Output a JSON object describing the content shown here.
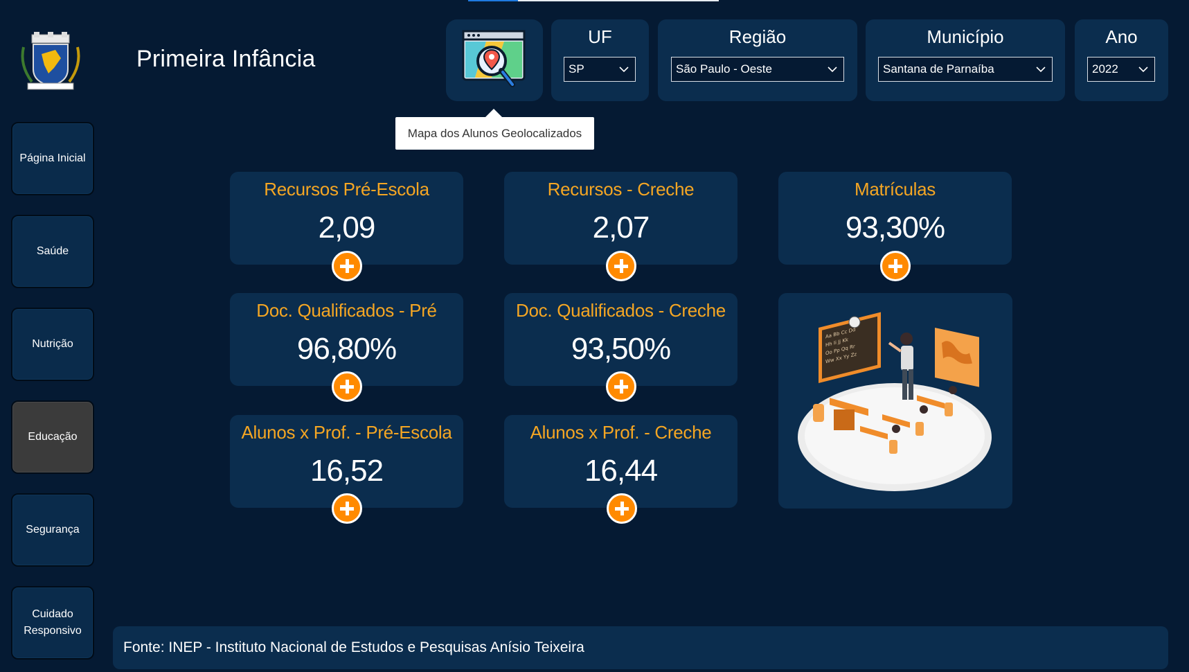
{
  "header": {
    "title": "Primeira Infância",
    "logo_icon": "municipal-coat-of-arms"
  },
  "nav": {
    "items": [
      {
        "label": "Página Inicial"
      },
      {
        "label": "Saúde"
      },
      {
        "label": "Nutrição"
      },
      {
        "label": "Educação",
        "active": true
      },
      {
        "label": "Segurança"
      },
      {
        "label": "Cuidado Responsivo"
      }
    ]
  },
  "map_button": {
    "icon": "map-search-icon",
    "tooltip": "Mapa dos Alunos Geolocalizados"
  },
  "filters": {
    "uf": {
      "label": "UF",
      "value": "SP"
    },
    "regiao": {
      "label": "Região",
      "value": "São Paulo - Oeste"
    },
    "municipio": {
      "label": "Município",
      "value": "Santana de Parnaíba"
    },
    "ano": {
      "label": "Ano",
      "value": "2022"
    }
  },
  "kpis": [
    {
      "title": "Recursos Pré-Escola",
      "value": "2,09"
    },
    {
      "title": "Recursos - Creche",
      "value": "2,07"
    },
    {
      "title": "Matrículas",
      "value": "93,30%"
    },
    {
      "title": "Doc. Qualificados - Pré",
      "value": "96,80%"
    },
    {
      "title": "Doc. Qualificados - Creche",
      "value": "93,50%"
    },
    {
      "title": "Alunos x Prof. - Pré-Escola",
      "value": "16,52"
    },
    {
      "title": "Alunos x Prof. - Creche",
      "value": "16,44"
    }
  ],
  "footer": {
    "source": "Fonte: INEP - Instituto Nacional de Estudos e Pesquisas Anísio Teixeira"
  },
  "colors": {
    "background": "#051a33",
    "card": "#0b2d4e",
    "accent_orange": "#ff8a00",
    "title_orange": "#f5a623",
    "active_nav": "#3b3b3b"
  }
}
